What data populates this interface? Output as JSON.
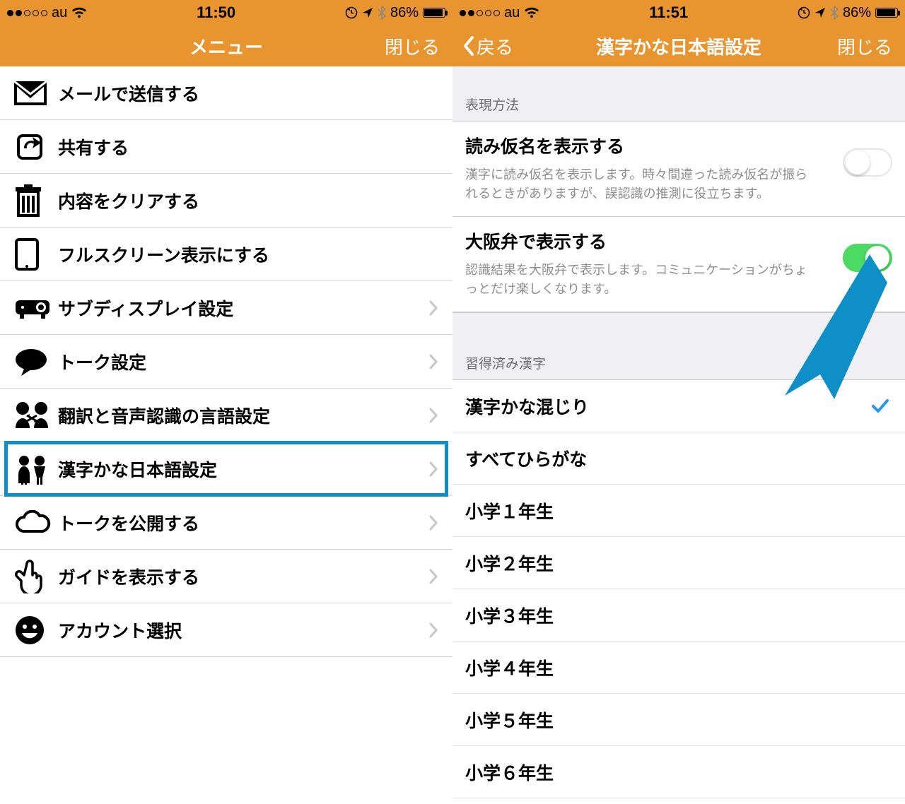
{
  "left": {
    "statusbar": {
      "carrier": "au",
      "time": "11:50",
      "battery_pct": "86%"
    },
    "nav": {
      "title": "メニュー",
      "close": "閉じる"
    },
    "items": [
      {
        "label": "メールで送信する",
        "icon": "mail-icon",
        "accessory": "none"
      },
      {
        "label": "共有する",
        "icon": "share-icon",
        "accessory": "none"
      },
      {
        "label": "内容をクリアする",
        "icon": "trash-icon",
        "accessory": "none"
      },
      {
        "label": "フルスクリーン表示にする",
        "icon": "fullscreen-icon",
        "accessory": "none"
      },
      {
        "label": "サブディスプレイ設定",
        "icon": "projector-icon",
        "accessory": "chevron"
      },
      {
        "label": "トーク設定",
        "icon": "talk-icon",
        "accessory": "chevron"
      },
      {
        "label": "翻訳と音声認識の言語設定",
        "icon": "translate-icon",
        "accessory": "chevron"
      },
      {
        "label": "漢字かな日本語設定",
        "icon": "kids-icon",
        "accessory": "chevron",
        "highlighted": true
      },
      {
        "label": "トークを公開する",
        "icon": "cloud-icon",
        "accessory": "chevron"
      },
      {
        "label": "ガイドを表示する",
        "icon": "hand-icon",
        "accessory": "chevron"
      },
      {
        "label": "アカウント選択",
        "icon": "smiley-icon",
        "accessory": "chevron"
      }
    ]
  },
  "right": {
    "statusbar": {
      "carrier": "au",
      "time": "11:51",
      "battery_pct": "86%"
    },
    "nav": {
      "back": "戻る",
      "title": "漢字かな日本語設定",
      "close": "閉じる"
    },
    "section1": {
      "header": "表現方法",
      "settings": [
        {
          "title": "読み仮名を表示する",
          "desc": "漢字に読み仮名を表示します。時々間違った読み仮名が振られるときがありますが、誤認識の推測に役立ちます。",
          "on": false
        },
        {
          "title": "大阪弁で表示する",
          "desc": "認識結果を大阪弁で表示します。コミュニケーションがちょっとだけ楽しくなります。",
          "on": true
        }
      ]
    },
    "section2": {
      "header": "習得済み漢字",
      "options": [
        {
          "label": "漢字かな混じり",
          "selected": true
        },
        {
          "label": "すべてひらがな",
          "selected": false
        },
        {
          "label": "小学１年生",
          "selected": false
        },
        {
          "label": "小学２年生",
          "selected": false
        },
        {
          "label": "小学３年生",
          "selected": false
        },
        {
          "label": "小学４年生",
          "selected": false
        },
        {
          "label": "小学５年生",
          "selected": false
        },
        {
          "label": "小学６年生",
          "selected": false
        }
      ]
    }
  }
}
